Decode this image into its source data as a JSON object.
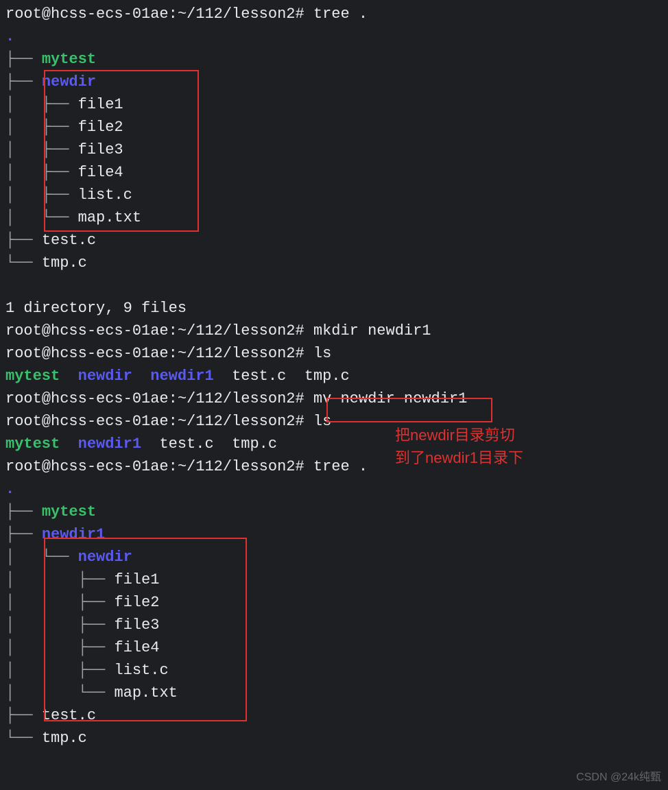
{
  "prompt": "root@hcss-ecs-01ae:~/112/lesson2#",
  "cmd": {
    "tree1": "tree .",
    "mkdir": "mkdir newdir1",
    "ls1": "ls",
    "mv": "mv newdir newdir1",
    "ls2": "ls",
    "tree2": "tree ."
  },
  "tree": {
    "dot": ".",
    "mytest": "mytest",
    "newdir": "newdir",
    "newdir1": "newdir1",
    "file1": "file1",
    "file2": "file2",
    "file3": "file3",
    "file4": "file4",
    "listc": "list.c",
    "maptxt": "map.txt",
    "testc": "test.c",
    "tmpc": "tmp.c",
    "summary": "1 directory, 9 files"
  },
  "ls_out": {
    "row1": {
      "mytest": "mytest",
      "newdir": "newdir",
      "newdir1": "newdir1",
      "testc": "test.c",
      "tmpc": "tmp.c"
    },
    "row2": {
      "mytest": "mytest",
      "newdir1": "newdir1",
      "testc": "test.c",
      "tmpc": "tmp.c"
    }
  },
  "anno": {
    "line1": "把newdir目录剪切",
    "line2": "到了newdir1目录下"
  },
  "branch": {
    "mid": "├── ",
    "last": "└── ",
    "pipe": "│   ",
    "sp": "    "
  },
  "watermark": "CSDN @24k纯甄"
}
